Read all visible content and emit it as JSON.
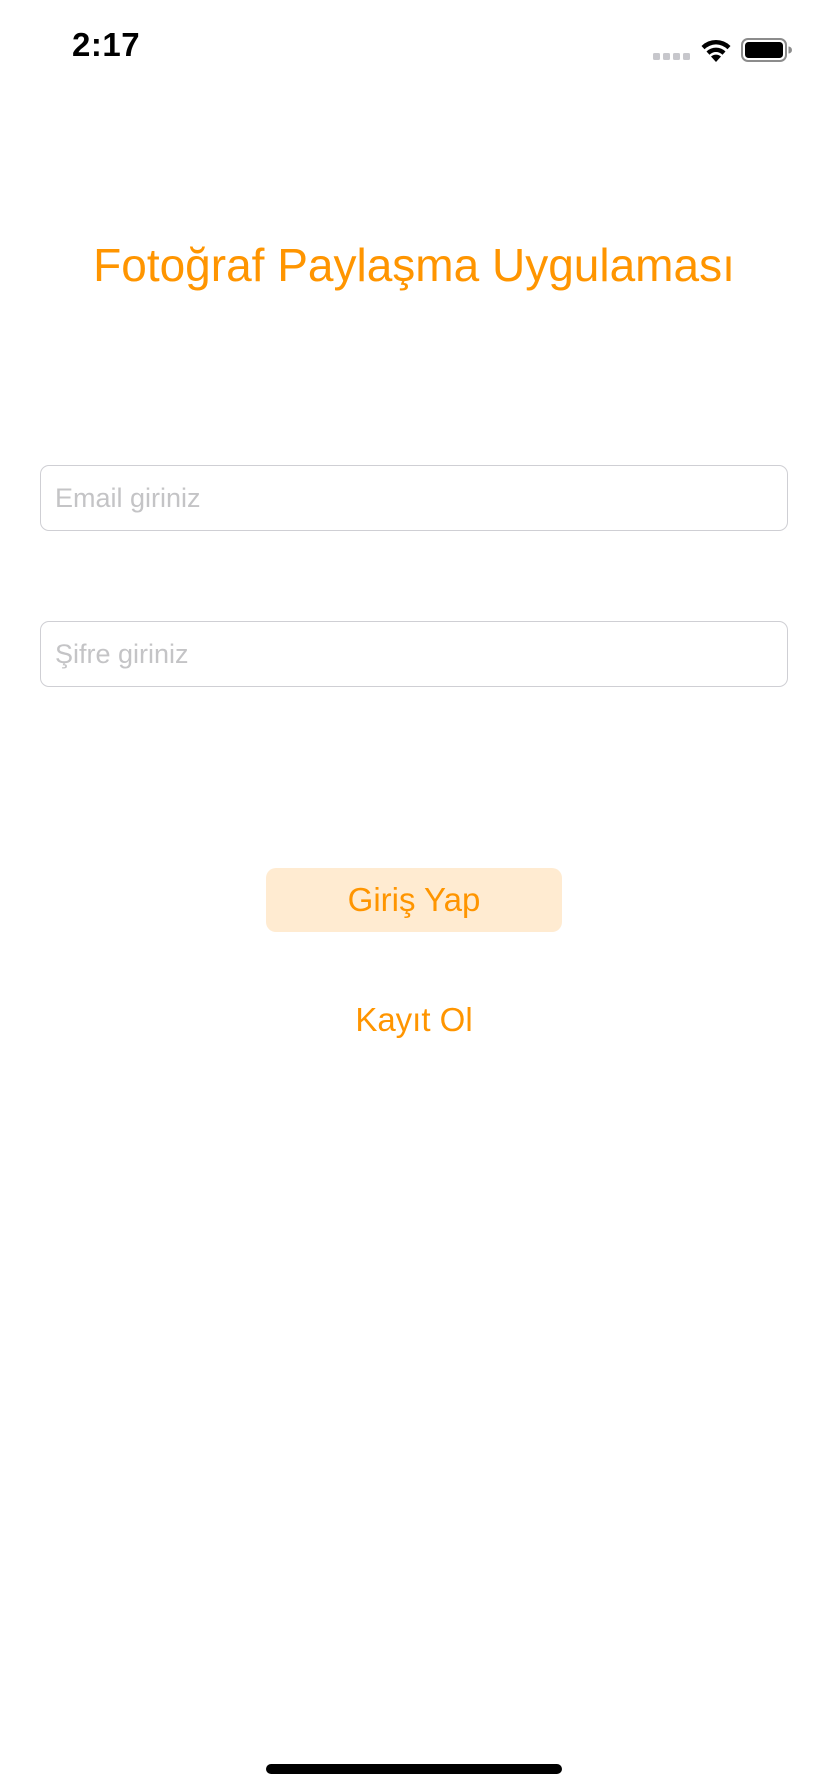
{
  "status_bar": {
    "time": "2:17",
    "icons": [
      "cellular-signal-icon",
      "wifi-icon",
      "battery-icon"
    ]
  },
  "app": {
    "title": "Fotoğraf Paylaşma Uygulaması",
    "accent_color": "#ff9500",
    "button_background": "#ffebd1"
  },
  "form": {
    "email_placeholder": "Email giriniz",
    "email_value": "",
    "password_placeholder": "Şifre giriniz",
    "password_value": "",
    "login_label": "Giriş Yap",
    "register_label": "Kayıt Ol"
  }
}
